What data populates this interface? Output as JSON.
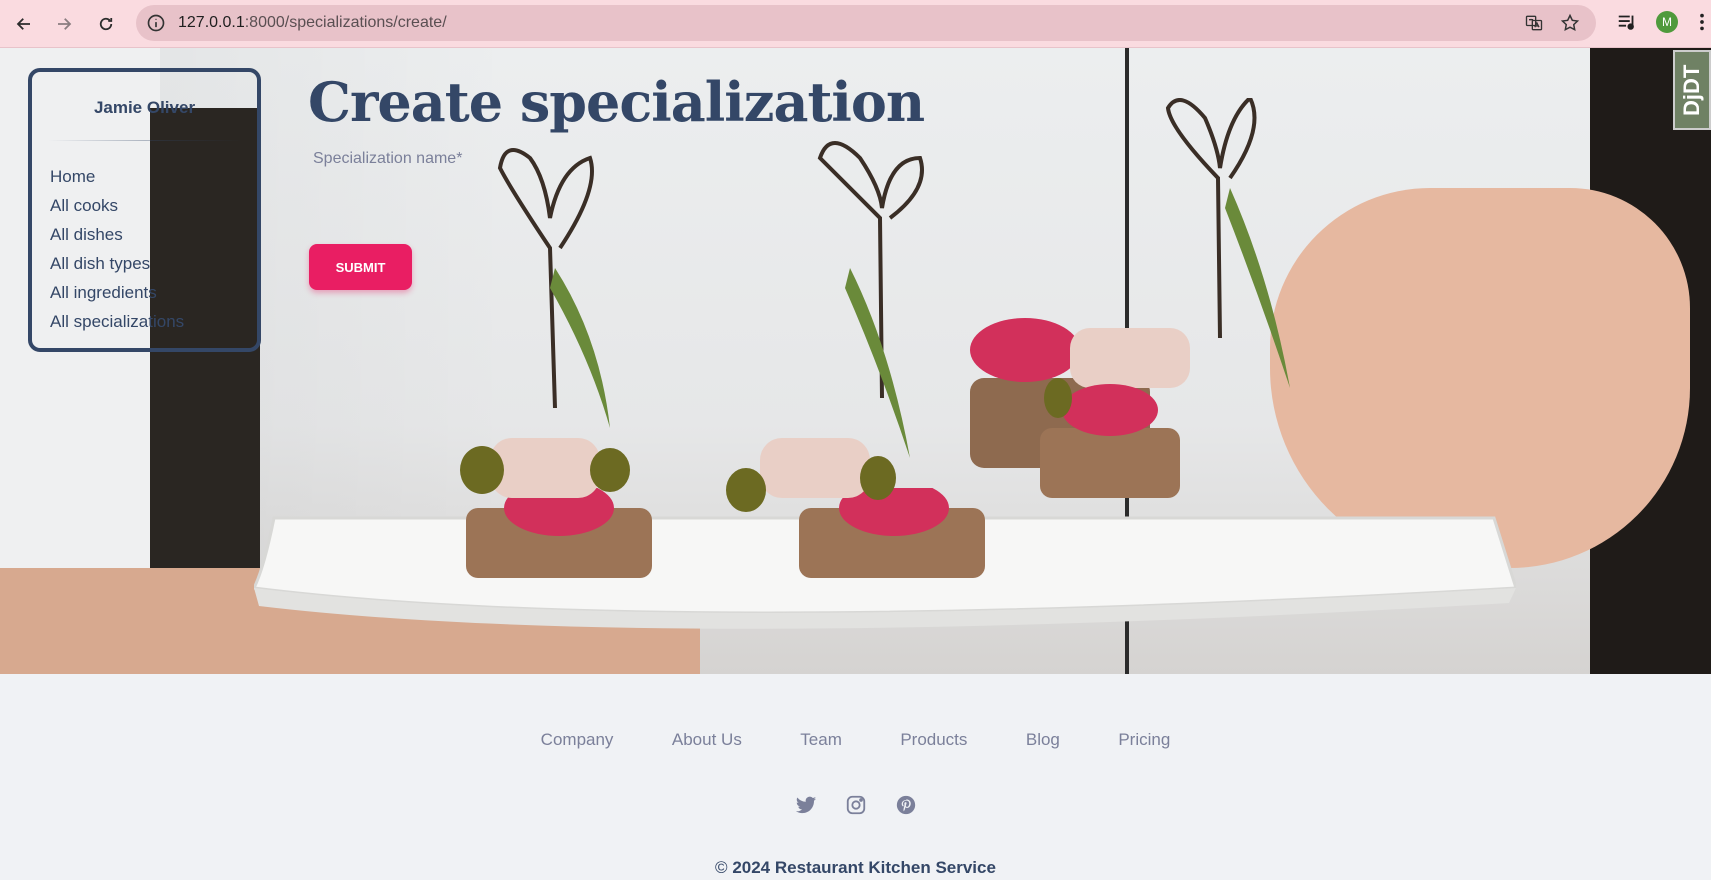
{
  "browser": {
    "url_host": "127.0.0.1",
    "url_rest": ":8000/specializations/create/",
    "profile_initial": "M"
  },
  "debug_toolbar": {
    "label": "DjDT"
  },
  "sidebar": {
    "user_name": "Jamie Oliver",
    "items": [
      {
        "label": "Home"
      },
      {
        "label": "All cooks"
      },
      {
        "label": "All dishes"
      },
      {
        "label": "All dish types"
      },
      {
        "label": "All ingredients"
      },
      {
        "label": "All specializations"
      }
    ]
  },
  "form": {
    "title": "Create specialization",
    "field_label": "Specialization name*",
    "field_value": "",
    "submit_label": "SUBMIT"
  },
  "footer": {
    "links": [
      "Company",
      "About Us",
      "Team",
      "Products",
      "Blog",
      "Pricing"
    ],
    "socials": [
      "twitter-icon",
      "instagram-icon",
      "pinterest-icon"
    ],
    "copyright_symbol": "©",
    "copyright_text": "2024 Restaurant Kitchen Service"
  }
}
